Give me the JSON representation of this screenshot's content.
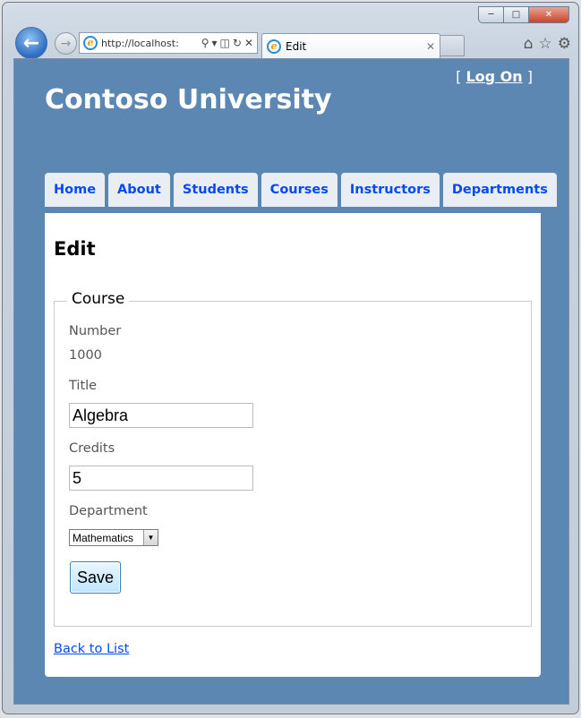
{
  "browser": {
    "address": "http://localhost:",
    "tab_title": "Edit"
  },
  "site": {
    "title": "Contoso University",
    "logon_prefix": "[",
    "logon_label": "Log On",
    "logon_suffix": "]"
  },
  "menu": [
    "Home",
    "About",
    "Students",
    "Courses",
    "Instructors",
    "Departments"
  ],
  "page": {
    "heading": "Edit",
    "legend": "Course",
    "number_label": "Number",
    "number_value": "1000",
    "title_label": "Title",
    "title_value": "Algebra",
    "credits_label": "Credits",
    "credits_value": "5",
    "department_label": "Department",
    "department_selected": "Mathematics",
    "save_label": "Save",
    "back_link": "Back to List"
  },
  "colors": {
    "site_background": "#5c87b2",
    "menu_tab_background": "#e8eef4",
    "link": "#034af3"
  },
  "icons": {
    "back": "back-arrow-icon",
    "forward": "forward-arrow-icon",
    "home": "home-icon",
    "favorites": "star-icon",
    "tools": "gear-icon"
  }
}
